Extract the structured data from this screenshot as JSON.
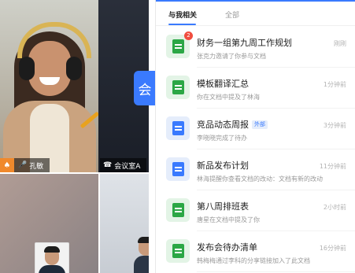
{
  "video": {
    "main_participant_name": "孔敏",
    "room_name": "会议室A",
    "meeting_button_glyph": "会"
  },
  "panel": {
    "tabs": [
      {
        "label": "与我相关",
        "active": true
      },
      {
        "label": "全部",
        "active": false
      }
    ],
    "docs": [
      {
        "type": "sheet",
        "icon": "sheet-icon",
        "title": "财务一组第九周工作规划",
        "tag": "",
        "subtitle": "张克力邀请了你参与文档",
        "time": "刚刚",
        "badge": "2"
      },
      {
        "type": "sheet",
        "icon": "sheet-icon",
        "title": "模板翻译汇总",
        "tag": "",
        "subtitle": "你在文档中提及了林海",
        "time": "1分钟前",
        "badge": ""
      },
      {
        "type": "doc",
        "icon": "doc-icon",
        "title": "竞品动态周报",
        "tag": "外部",
        "subtitle": "李晓晓完成了待办",
        "time": "3分钟前",
        "badge": ""
      },
      {
        "type": "doc",
        "icon": "doc-icon",
        "title": "新品发布计划",
        "tag": "",
        "subtitle": "林海提醒你查看文档的改动：文档有新的改动",
        "time": "11分钟前",
        "badge": ""
      },
      {
        "type": "sheet",
        "icon": "sheet-icon",
        "title": "第八周排班表",
        "tag": "",
        "subtitle": "唐星在文档中提及了你",
        "time": "2小时前",
        "badge": ""
      },
      {
        "type": "sheet",
        "icon": "sheet-icon",
        "title": "发布会待办清单",
        "tag": "",
        "subtitle": "韩梅梅通过李科的分享链接加入了此文档",
        "time": "16分钟前",
        "badge": ""
      }
    ]
  },
  "colors": {
    "accent": "#3a7afe",
    "sheet_green": "#2ba745",
    "badge_red": "#f04d3f",
    "host_orange": "#f0892c"
  }
}
